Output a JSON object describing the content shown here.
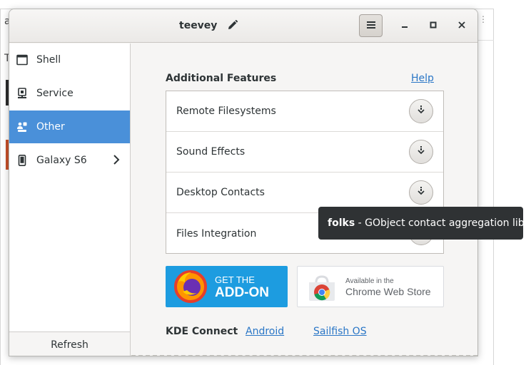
{
  "background": {
    "frag_a": "a",
    "frag_t": "T",
    "frag_dots": "⋮"
  },
  "window": {
    "title": "teevey",
    "icons": {
      "edit": "pencil-icon",
      "menu": "hamburger-menu-icon",
      "minimize": "minimize-icon",
      "maximize": "maximize-icon",
      "close": "close-icon"
    }
  },
  "sidebar": {
    "items": [
      {
        "label": "Shell",
        "icon": "terminal-window-icon"
      },
      {
        "label": "Service",
        "icon": "service-icon"
      },
      {
        "label": "Other",
        "icon": "other-plugins-icon"
      },
      {
        "label": "Galaxy S6",
        "icon": "phone-icon"
      }
    ],
    "selected": "Other",
    "refresh_label": "Refresh"
  },
  "content": {
    "section_title": "Additional Features",
    "help_label": "Help",
    "features": [
      {
        "label": "Remote Filesystems"
      },
      {
        "label": "Sound Effects"
      },
      {
        "label": "Desktop Contacts"
      },
      {
        "label": "Files Integration"
      }
    ],
    "firefox_badge": {
      "line1": "GET THE",
      "line2": "ADD-ON"
    },
    "chrome_badge": {
      "line1": "Available in the",
      "line2": "Chrome Web Store"
    },
    "kde": {
      "label": "KDE Connect",
      "android": "Android",
      "sailfish": "Sailfish OS"
    }
  },
  "tooltip": {
    "name": "folks",
    "description": " - GObject contact aggregation library"
  },
  "colors": {
    "selection": "#4a90d9",
    "link": "#2a76c6",
    "tooltip_bg": "#2f3234",
    "firefox_badge": "#1d9ce0"
  }
}
